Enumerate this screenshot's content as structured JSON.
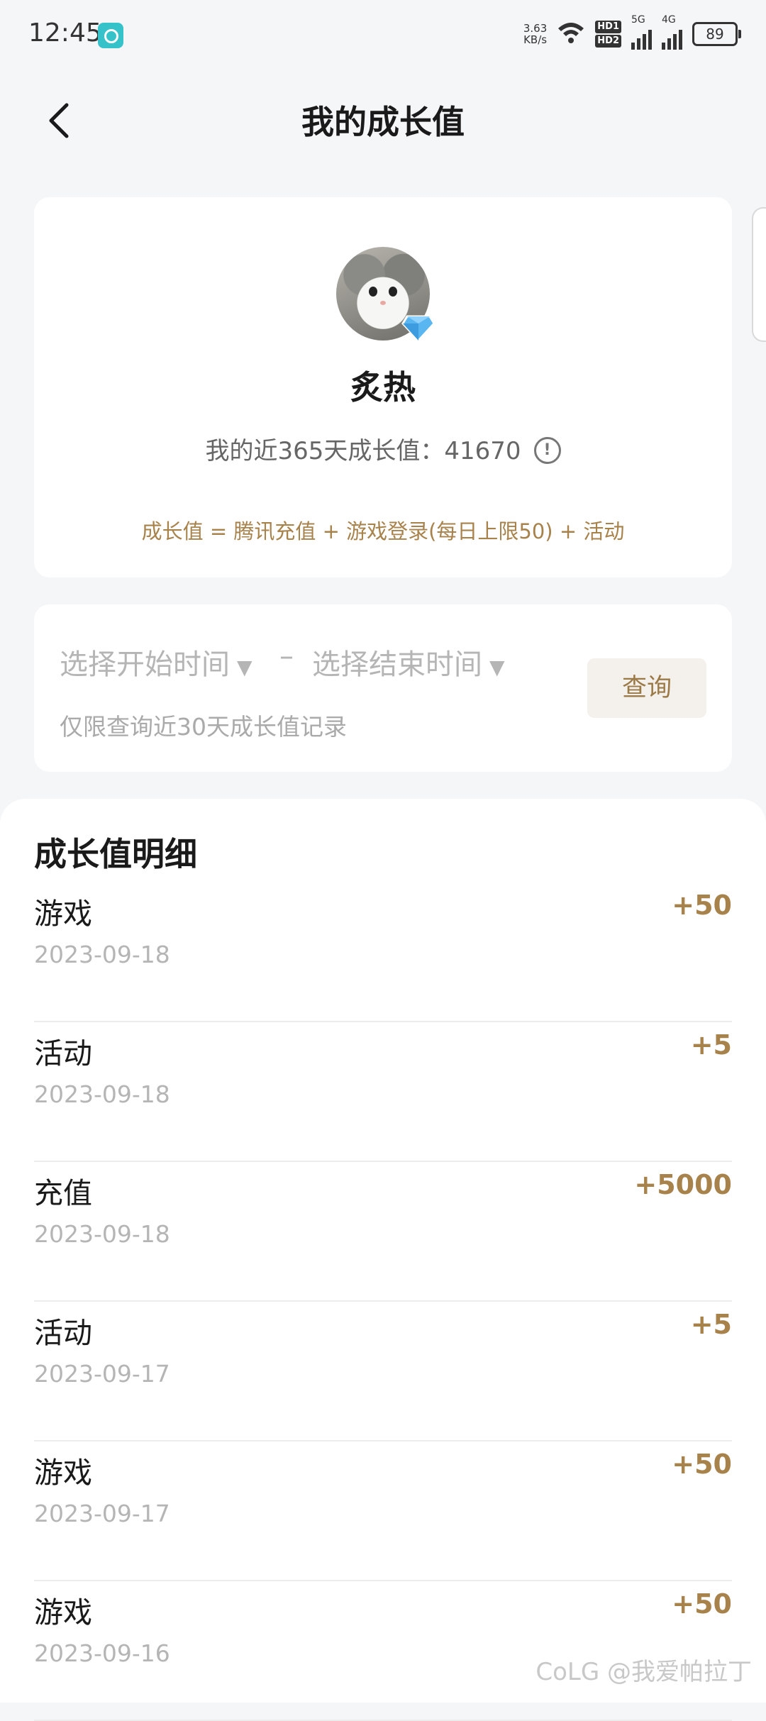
{
  "status_bar": {
    "time": "12:45",
    "net_speed_value": "3.63",
    "net_speed_unit": "KB/s",
    "hd1": "HD1",
    "hd2": "HD2",
    "sig1_label": "5G",
    "sig2_label": "4G",
    "battery": "89"
  },
  "nav": {
    "title": "我的成长值"
  },
  "profile": {
    "username": "炙热",
    "growth_label": "我的近365天成长值：41670",
    "formula": "成长值 = 腾讯充值 + 游戏登录(每日上限50) + 活动"
  },
  "query": {
    "start_placeholder": "选择开始时间",
    "separator": "–",
    "end_placeholder": "选择结束时间",
    "note": "仅限查询近30天成长值记录",
    "button": "查询"
  },
  "detail": {
    "title": "成长值明细",
    "rows": [
      {
        "type": "游戏",
        "date": "2023-09-18",
        "value": "+50"
      },
      {
        "type": "活动",
        "date": "2023-09-18",
        "value": "+5"
      },
      {
        "type": "充值",
        "date": "2023-09-18",
        "value": "+5000"
      },
      {
        "type": "活动",
        "date": "2023-09-17",
        "value": "+5"
      },
      {
        "type": "游戏",
        "date": "2023-09-17",
        "value": "+50"
      },
      {
        "type": "游戏",
        "date": "2023-09-16",
        "value": "+50"
      }
    ]
  },
  "watermark": "CoLG @我爱帕拉丁",
  "colors": {
    "accent": "#a8824b",
    "background": "#f5f6f8"
  }
}
